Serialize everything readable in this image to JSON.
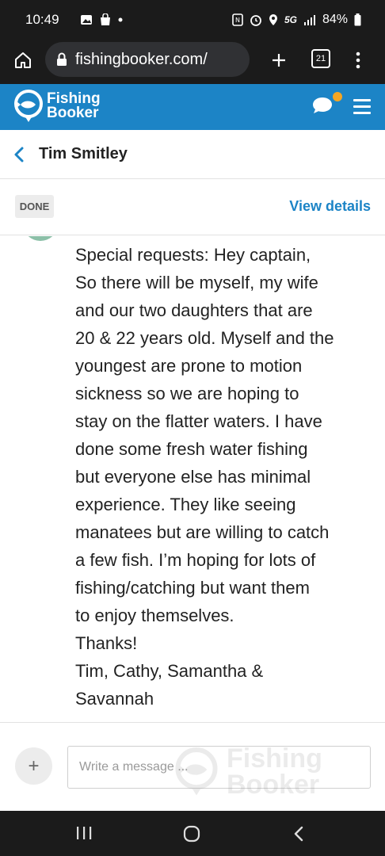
{
  "status_bar": {
    "time": "10:49",
    "network": "5G",
    "battery": "84%"
  },
  "browser": {
    "url": "fishingbooker.com/",
    "tab_count": "21"
  },
  "site_header": {
    "logo_line1": "Fishing",
    "logo_line2": "Booker",
    "brand_color": "#1c84c6",
    "notification_color": "#f5a623"
  },
  "conversation": {
    "name": "Tim Smitley"
  },
  "booking": {
    "status_badge": "DONE",
    "view_details_label": "View details"
  },
  "message": {
    "lines": [
      "Special requests: Hey captain,",
      "So there will be myself, my wife",
      "and our two daughters that are",
      "20 & 22 years old. Myself and the",
      "youngest are prone to motion",
      "sickness so we are hoping to",
      "stay on the flatter waters. I have",
      "done some fresh water fishing",
      "but everyone else has minimal",
      "experience. They like seeing",
      "manatees but are willing to catch",
      "a few fish. I’m hoping for lots of",
      "fishing/catching but want them",
      "to enjoy themselves.",
      "Thanks!",
      "Tim, Cathy, Samantha &",
      "Savannah"
    ]
  },
  "compose": {
    "add_label": "+",
    "placeholder": "Write a message ...",
    "watermark_line1": "Fishing",
    "watermark_line2": "Booker"
  }
}
